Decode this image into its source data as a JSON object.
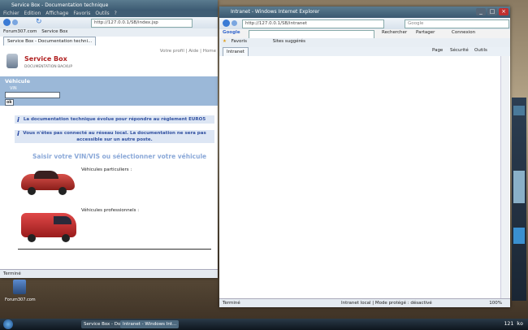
{
  "left_window": {
    "title": "Service Box - Documentation technique",
    "menu": [
      "Fichier",
      "Edition",
      "Affichage",
      "Favoris",
      "Outils",
      "?"
    ],
    "address": "http://127.0.0.1/SB/index.jsp",
    "favorites": [
      "Forum307.com",
      "Service Box"
    ],
    "tab_label": "Service Box - Documentation techni...",
    "header_links": "Votre profil | Aide | Home",
    "brand_title": "Service Box",
    "brand_subtitle": "DOCUMENTATION BACKUP",
    "section_label": "Véhicule",
    "vin_label": "VIN",
    "vin_value": "",
    "ok_label": "ok",
    "info_1": "La documentation technique évolue pour répondre au règlement EURO5",
    "info_2": "Vous n'êtes pas connecté au réseau local. La documentation ne sera pas accessible sur un autre poste.",
    "prompt": "Saisir votre VIN/VIS ou sélectionner votre véhicule",
    "vehicles": [
      {
        "label": "Véhicules particuliers :"
      },
      {
        "label": "Véhicules professionnels :"
      }
    ],
    "status": "Terminé"
  },
  "right_window": {
    "title": "Intranet - Windows Internet Explorer",
    "address": "http://127.0.0.1/SB/intranet",
    "search_placeholder": "Google",
    "google_label": "Google",
    "google_buttons": [
      "Rechercher",
      "Partager",
      "Connexion"
    ],
    "favorites": [
      "Favoris",
      "Sites suggérés"
    ],
    "tab_label": "Intranet",
    "cmd": [
      "Page",
      "Sécurité",
      "Outils"
    ],
    "status_left": "Terminé",
    "status_zone": "Intranet local | Mode protégé : désactivé",
    "zoom": "100%"
  },
  "desktop": {
    "icon_label": "Forum307.com"
  },
  "taskbar": {
    "items": [
      "Service Box - Docum...",
      "Intranet - Windows Int..."
    ],
    "clock": "121 ko"
  }
}
